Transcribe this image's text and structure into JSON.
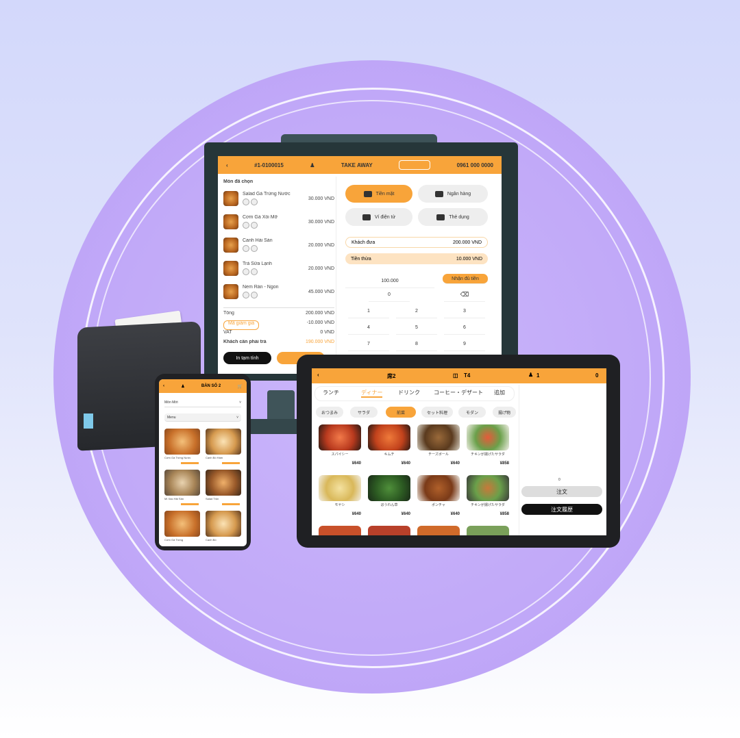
{
  "monitor": {
    "header": {
      "left": "#1-0100015",
      "center": "TAKE AWAY",
      "right": "0961 000 0000"
    },
    "order_title": "Món đã chọn",
    "items": [
      {
        "name": "Salad Gà Trứng Nước",
        "price": "30.000 VND"
      },
      {
        "name": "Cơm Gà Xối Mỡ",
        "price": "30.000 VND"
      },
      {
        "name": "Canh Hải Sản",
        "price": "20.000 VND"
      },
      {
        "name": "Trà Sữa Lạnh",
        "price": "20.000 VND"
      },
      {
        "name": "Nem Rán - Ngon",
        "price": "45.000 VND"
      }
    ],
    "total_label": "Tổng",
    "total_value": "200.000 VND",
    "discount_label": "Mã giảm giá",
    "discount_value": "-10.000 VND",
    "vat_label": "VAT",
    "vat_value": "0 VND",
    "pay_label": "Khách cần phải trả",
    "pay_value": "190.000 VND",
    "cancel_button": "In tạm tính",
    "pay_methods": [
      "Tiền mặt",
      "Ngân hàng",
      "Ví điện tử",
      "Thẻ dụng"
    ],
    "cash_label": "Khách đưa",
    "cash_value": "200.000 VND",
    "change_label": "Tiền thừa",
    "change_value": "10.000 VND",
    "keypad": {
      "quick": "100.000",
      "exact": "Nhận đủ tiền",
      "keys": [
        "0",
        "1",
        "2",
        "3",
        "4",
        "5",
        "6",
        "7",
        "8",
        "9"
      ]
    }
  },
  "phone": {
    "header": "BÀN SỐ 2",
    "select1": "Món Mới",
    "select2": "Menu",
    "foods": [
      "Cơm Gà Trứng Nước",
      "Canh Bò Hầm",
      "Mì Xào Hải Sản",
      "Salad Trộn",
      "Cơm Gà Trứng",
      "Canh Bò"
    ]
  },
  "tablet": {
    "header": {
      "left": "席2",
      "table": "T4",
      "guests": "1",
      "right": "0"
    },
    "categories": [
      "ランチ",
      "ディナー",
      "ドリンク",
      "コーヒー・デザート",
      "追加"
    ],
    "chips": [
      "おつまみ",
      "サラダ",
      "前菜",
      "セット料理",
      "モダン",
      "揚げ物"
    ],
    "foods": [
      {
        "name": "スパイシー",
        "price": "¥640"
      },
      {
        "name": "キムチ",
        "price": "¥640"
      },
      {
        "name": "チーズボール",
        "price": "¥640"
      },
      {
        "name": "チキンが揚げたサラダ",
        "price": "¥858"
      },
      {
        "name": "モヤシ",
        "price": "¥640"
      },
      {
        "name": "ほうれん草",
        "price": "¥640"
      },
      {
        "name": "ポンチャ",
        "price": "¥640"
      },
      {
        "name": "チキンが揚げたサラダ",
        "price": "¥858"
      }
    ],
    "count": "0",
    "order_button": "注文",
    "history_button": "注文履歴"
  }
}
